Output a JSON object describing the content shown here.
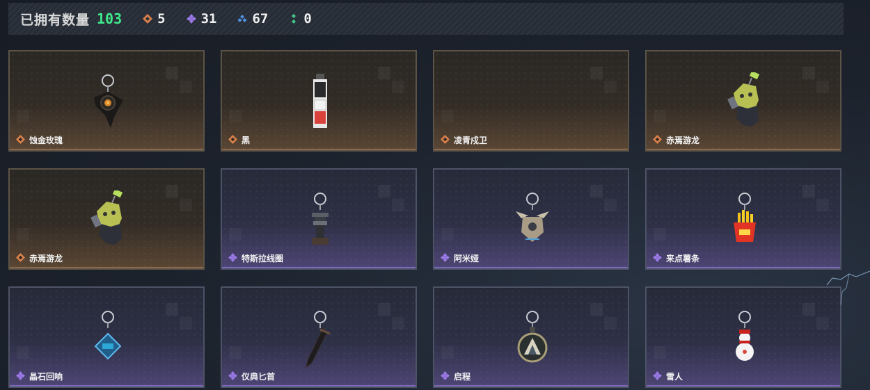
{
  "header": {
    "owned_label": "已拥有数量",
    "owned_count": "103",
    "stats": [
      {
        "icon": "orange-rarity-icon",
        "color": "#d9804a",
        "value": "5"
      },
      {
        "icon": "purple-rarity-icon",
        "color": "#9b7ae8",
        "value": "31"
      },
      {
        "icon": "blue-rarity-icon",
        "color": "#4f8fe0",
        "value": "67"
      },
      {
        "icon": "green-rarity-icon",
        "color": "#3ec98a",
        "value": "0"
      }
    ]
  },
  "items": [
    {
      "name": "蚀金玫瑰",
      "rarity": "orange",
      "charm": "dark-rose-charm"
    },
    {
      "name": "黑",
      "rarity": "orange",
      "charm": "black-tag-charm"
    },
    {
      "name": "凌青戍卫",
      "rarity": "orange",
      "charm": "empty"
    },
    {
      "name": "赤焉游龙",
      "rarity": "orange",
      "charm": "dragon-figure-charm"
    },
    {
      "name": "赤焉游龙",
      "rarity": "orange",
      "charm": "dragon-figure-charm"
    },
    {
      "name": "特斯拉线圈",
      "rarity": "purple",
      "charm": "tesla-coil-charm"
    },
    {
      "name": "阿米娅",
      "rarity": "purple",
      "charm": "amiya-charm"
    },
    {
      "name": "来点薯条",
      "rarity": "purple",
      "charm": "fries-charm"
    },
    {
      "name": "晶石回响",
      "rarity": "purple",
      "charm": "crystal-tag-charm"
    },
    {
      "name": "仪典匕首",
      "rarity": "purple",
      "charm": "dagger-charm"
    },
    {
      "name": "启程",
      "rarity": "purple",
      "charm": "medal-charm"
    },
    {
      "name": "雪人",
      "rarity": "purple",
      "charm": "snowman-charm"
    }
  ]
}
